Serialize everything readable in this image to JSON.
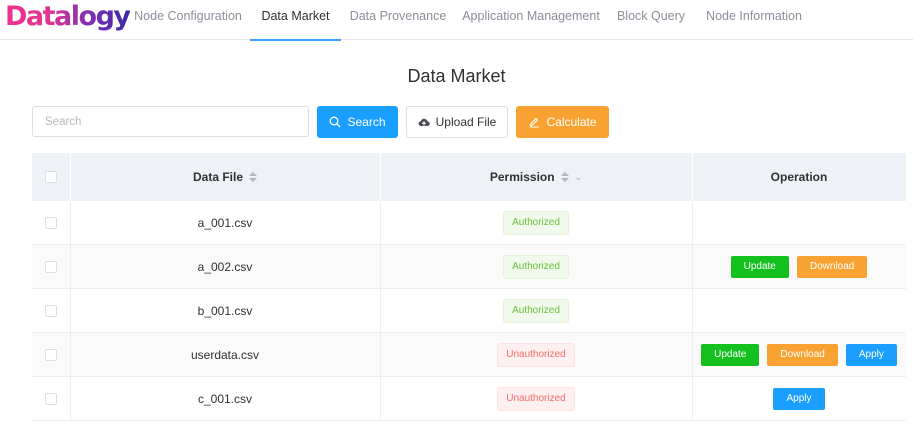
{
  "brand": {
    "logo_text": "Datalogy"
  },
  "nav": {
    "items": [
      {
        "label": "Node Configuration"
      },
      {
        "label": "Data Market"
      },
      {
        "label": "Data Provenance"
      },
      {
        "label": "Application Management"
      },
      {
        "label": "Block Query"
      },
      {
        "label": "Node Information"
      }
    ],
    "active": "Data Market"
  },
  "page": {
    "title": "Data Market"
  },
  "toolbar": {
    "search_placeholder": "Search",
    "search_value": "",
    "search_label": "Search",
    "upload_label": "Upload File",
    "calculate_label": "Calculate"
  },
  "table": {
    "headers": {
      "data_file": "Data File",
      "permission": "Permission",
      "operation": "Operation"
    },
    "rows": [
      {
        "file": "a_001.csv",
        "permission": "Authorized",
        "status": "authorized",
        "actions": []
      },
      {
        "file": "a_002.csv",
        "permission": "Authorized",
        "status": "authorized",
        "actions": [
          "Update",
          "Download"
        ]
      },
      {
        "file": "b_001.csv",
        "permission": "Authorized",
        "status": "authorized",
        "actions": []
      },
      {
        "file": "userdata.csv",
        "permission": "Unauthorized",
        "status": "unauthorized",
        "actions": [
          "Update",
          "Download",
          "Apply"
        ]
      },
      {
        "file": "c_001.csv",
        "permission": "Unauthorized",
        "status": "unauthorized",
        "actions": [
          "Apply"
        ]
      }
    ]
  },
  "colors": {
    "primary": "#1a9eff",
    "warning": "#f8a231",
    "success": "#13c01e",
    "authorized_text": "#67c23a",
    "unauthorized_text": "#f56c6c"
  },
  "icons": {
    "search_button": "search-icon",
    "upload_button": "cloud-upload-icon",
    "calculate_button": "edit-icon",
    "sort": "sort-icon",
    "filter": "chevron-down-icon"
  }
}
